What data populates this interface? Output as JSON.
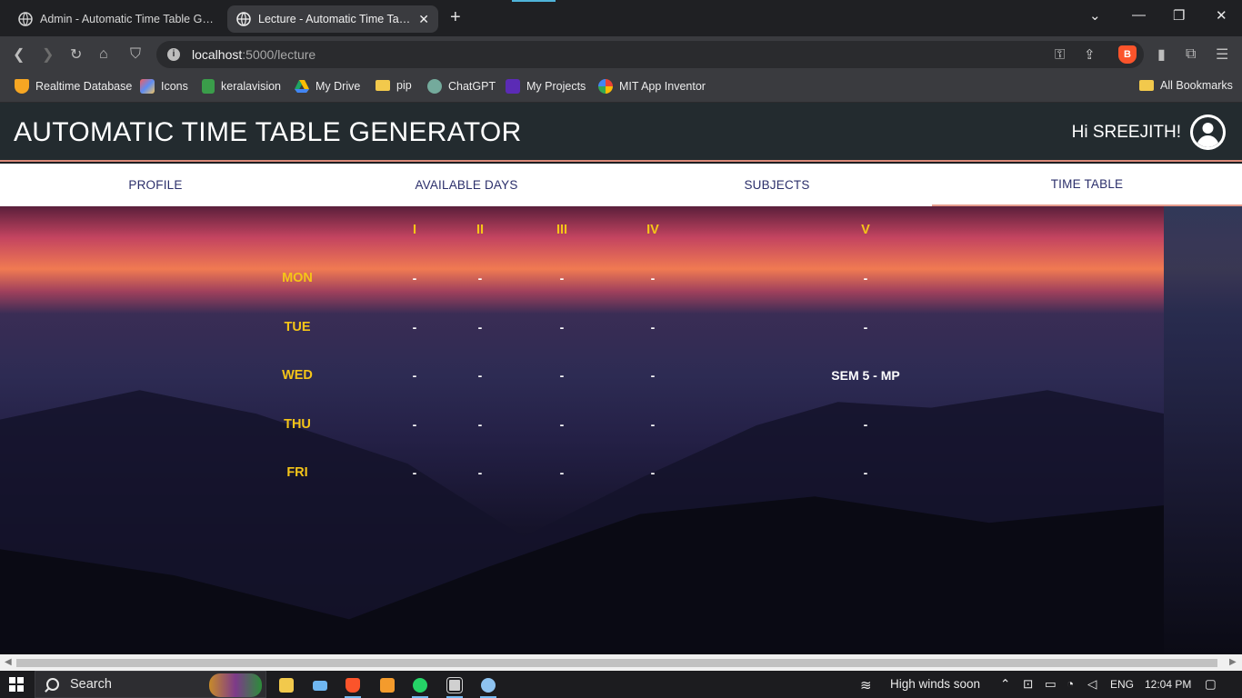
{
  "browser": {
    "tabs": [
      {
        "title": "Admin - Automatic Time Table Generator",
        "active": false
      },
      {
        "title": "Lecture - Automatic Time Table Generator",
        "active": true
      }
    ],
    "address": {
      "host": "localhost",
      "path": ":5000/lecture"
    },
    "bookmarks": [
      {
        "label": "Realtime Database",
        "icon": "firebase-icon",
        "color": "#f6a623"
      },
      {
        "label": "Icons",
        "icon": "icons-icon",
        "color": "#7b68ee"
      },
      {
        "label": "keralavision",
        "icon": "keralavision-icon",
        "color": "#3a9d4a"
      },
      {
        "label": "My Drive",
        "icon": "google-drive-icon",
        "color": "#1fa463"
      },
      {
        "label": "pip",
        "icon": "folder-icon",
        "color": "#f2c94c"
      },
      {
        "label": "ChatGPT",
        "icon": "chatgpt-icon",
        "color": "#74aa9c"
      },
      {
        "label": "My Projects",
        "icon": "projects-icon",
        "color": "#7c3aed"
      },
      {
        "label": "MIT App Inventor",
        "icon": "google-icon",
        "color": "#ffffff"
      }
    ],
    "all_bookmarks": "All Bookmarks"
  },
  "app": {
    "title": "AUTOMATIC TIME TABLE GENERATOR",
    "greeting": "Hi SREEJITH!",
    "nav": [
      {
        "label": "PROFILE",
        "active": false
      },
      {
        "label": "AVAILABLE DAYS",
        "active": false
      },
      {
        "label": "SUBJECTS",
        "active": false
      },
      {
        "label": "TIME TABLE",
        "active": true
      }
    ],
    "accent_color": "#f5c518",
    "underline_color": "#e59b8c"
  },
  "timetable": {
    "periods": [
      "I",
      "II",
      "III",
      "IV",
      "V"
    ],
    "days": [
      {
        "day": "MON",
        "slots": [
          "-",
          "-",
          "-",
          "-",
          "-"
        ]
      },
      {
        "day": "TUE",
        "slots": [
          "-",
          "-",
          "-",
          "-",
          "-"
        ]
      },
      {
        "day": "WED",
        "slots": [
          "-",
          "-",
          "-",
          "-",
          "SEM 5 - MP"
        ]
      },
      {
        "day": "THU",
        "slots": [
          "-",
          "-",
          "-",
          "-",
          "-"
        ]
      },
      {
        "day": "FRI",
        "slots": [
          "-",
          "-",
          "-",
          "-",
          "-"
        ]
      }
    ]
  },
  "taskbar": {
    "search_placeholder": "Search",
    "weather": "High winds soon",
    "language": "ENG",
    "time": "12:04 PM"
  }
}
